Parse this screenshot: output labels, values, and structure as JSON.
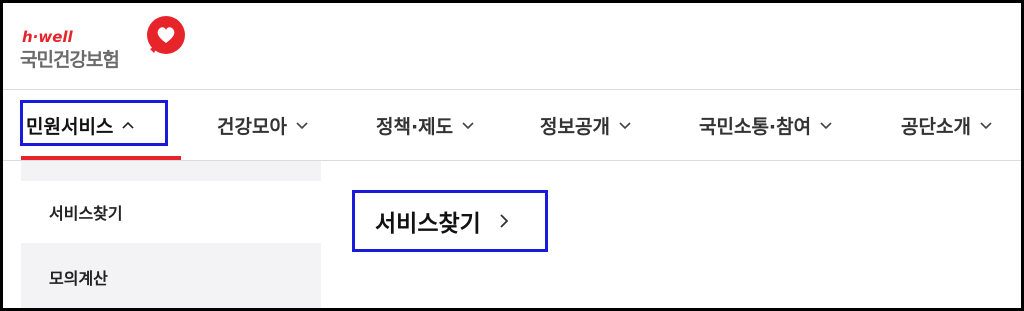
{
  "logo": {
    "tagline": "h·well",
    "name": "국민건강보험"
  },
  "nav": {
    "items": [
      {
        "label": "민원서비스",
        "icon": "chevron-up-icon"
      },
      {
        "label": "건강모아",
        "icon": "chevron-down-icon"
      },
      {
        "label": "정책·제도",
        "icon": "chevron-down-icon"
      },
      {
        "label": "정보공개",
        "icon": "chevron-down-icon"
      },
      {
        "label": "국민소통·참여",
        "icon": "chevron-down-icon"
      },
      {
        "label": "공단소개",
        "icon": "chevron-down-icon"
      }
    ]
  },
  "submenu": {
    "items": [
      {
        "label": "서비스찾기"
      },
      {
        "label": "모의계산"
      }
    ]
  },
  "content": {
    "heading": "서비스찾기",
    "heading_icon": "chevron-right-icon"
  },
  "colors": {
    "brand_red": "#e8242b",
    "highlight_blue": "#1a1adb",
    "submenu_bg": "#f3f3f5"
  }
}
